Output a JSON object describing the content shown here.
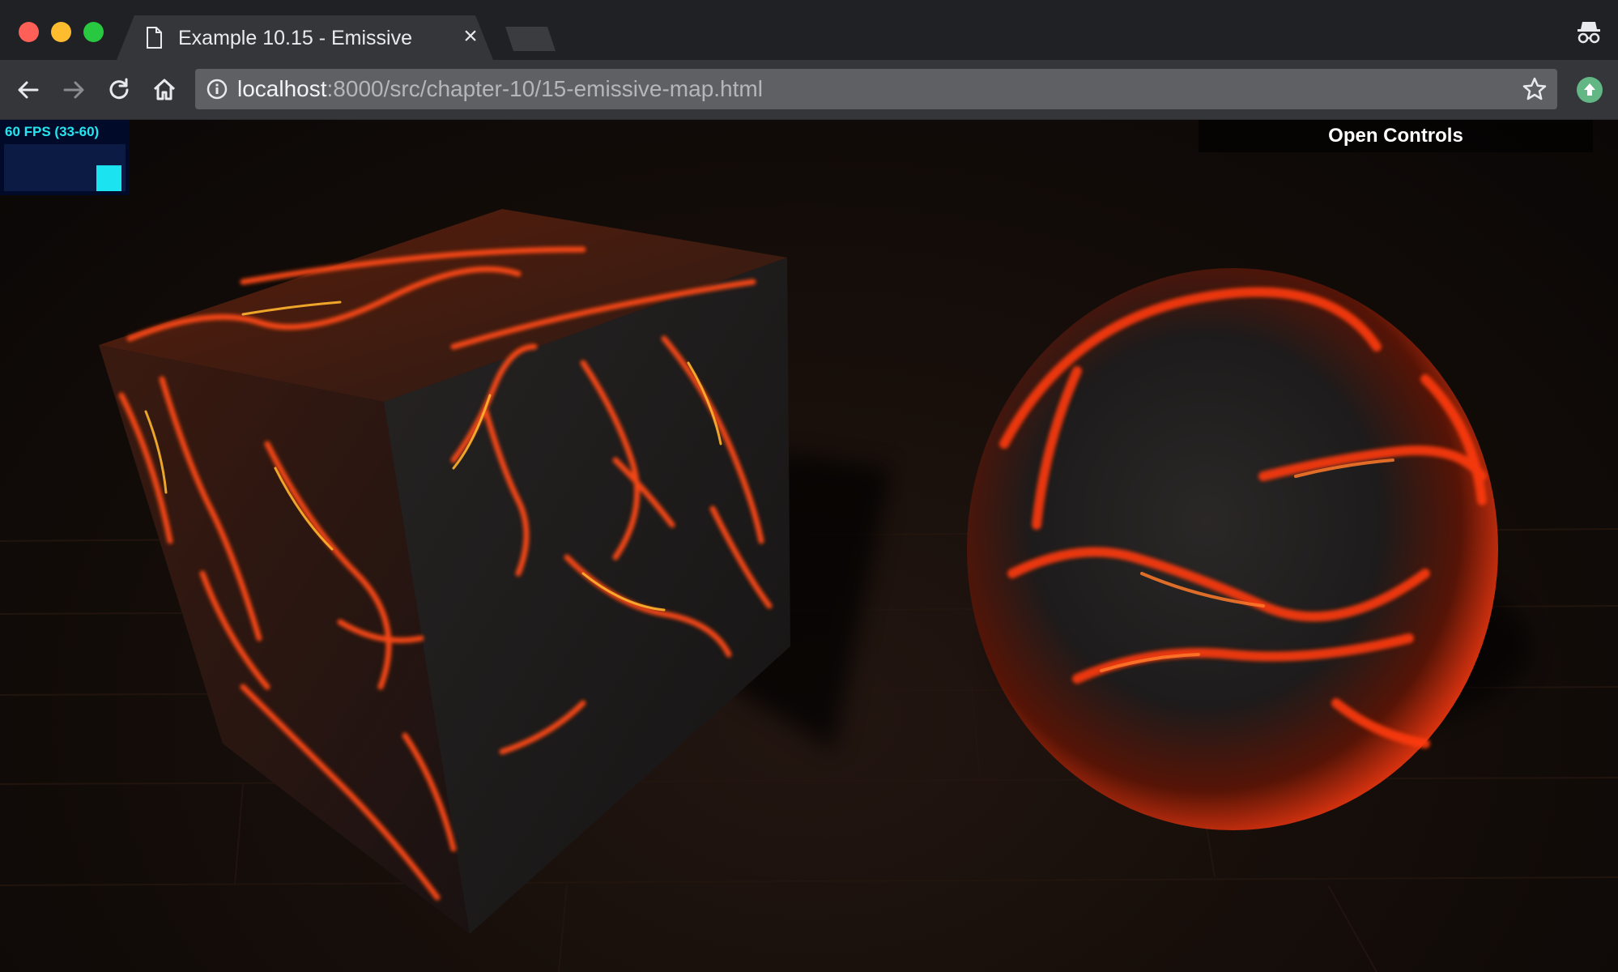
{
  "browser": {
    "tab_title": "Example 10.15 - Emissive",
    "tab_close": "×",
    "url_host": "localhost",
    "url_path": ":8000/src/chapter-10/15-emissive-map.html"
  },
  "stats": {
    "label": "60 FPS (33-60)",
    "level": 0.55,
    "color": "#1be3f0"
  },
  "controls": {
    "open_label": "Open Controls"
  },
  "icons": {
    "back": "arrow-left",
    "forward": "arrow-right",
    "reload": "reload",
    "home": "home",
    "info": "info-circle",
    "bookmark": "star",
    "incognito": "incognito",
    "extension": "upload-arrow"
  },
  "colors": {
    "lava": "#ff3a0e",
    "rock": "#1c1a1a"
  }
}
